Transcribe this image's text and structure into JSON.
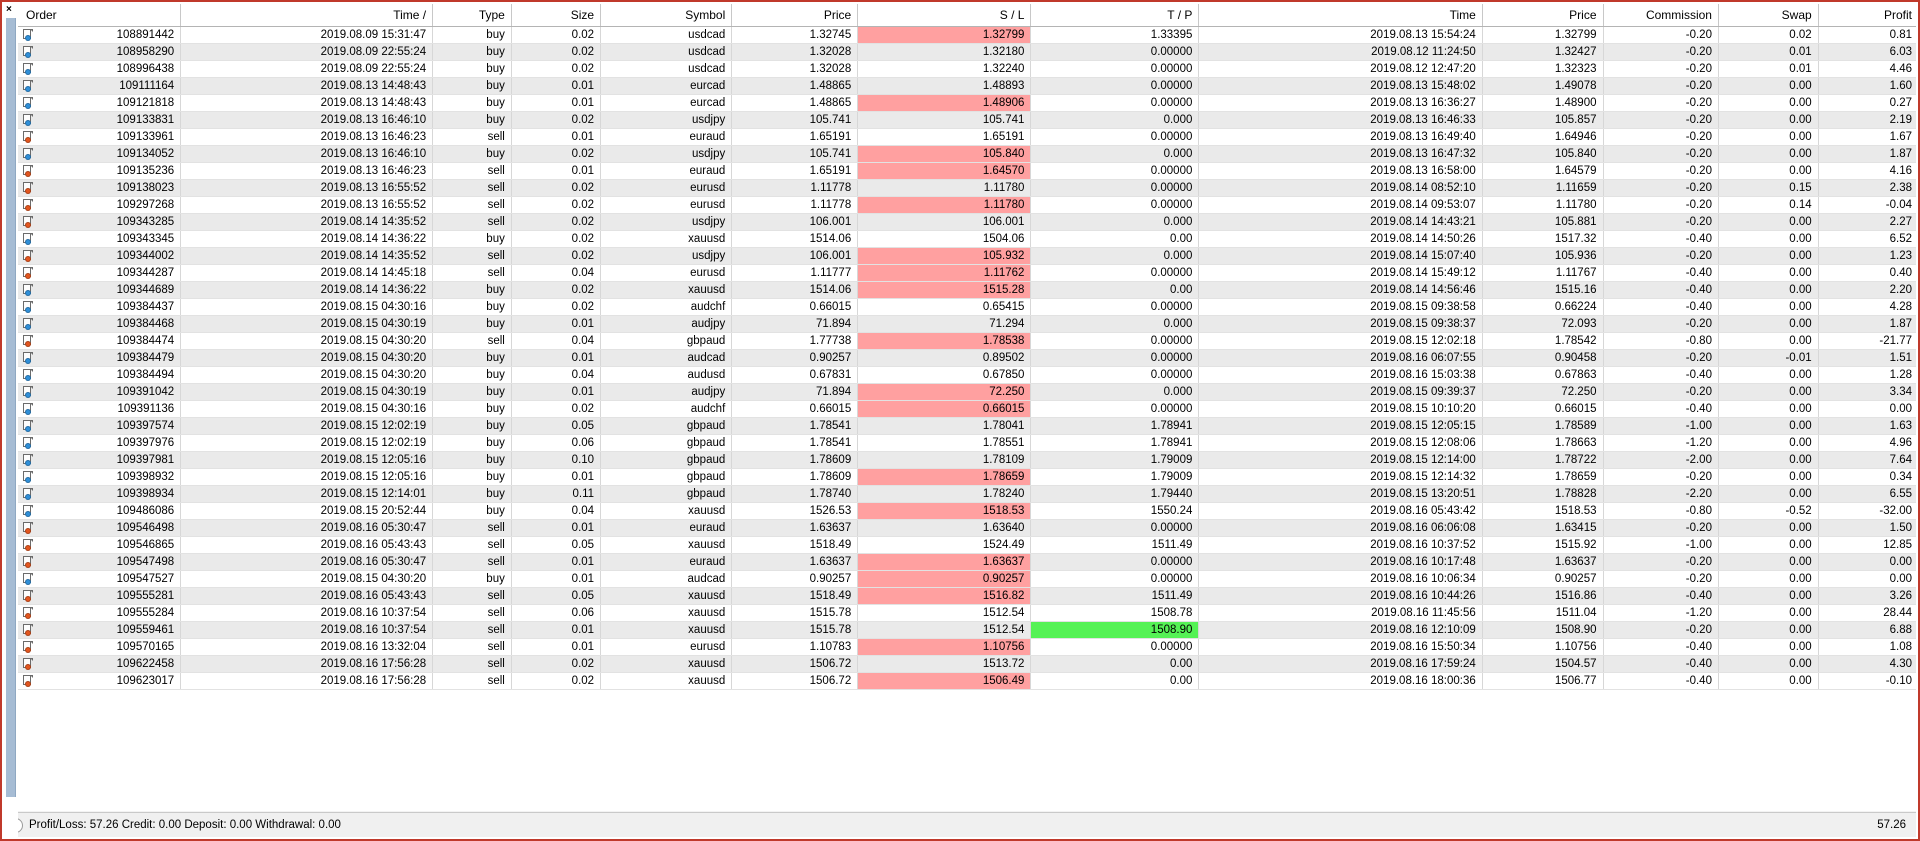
{
  "window": {
    "close_glyph": "×",
    "accent_border": "#c0392b"
  },
  "colors": {
    "highlight_red": "#ffa0a0",
    "highlight_green": "#55f255",
    "row_even": "#eaeaea",
    "row_odd": "#ffffff",
    "buy_dot": "#2f8fd8",
    "sell_dot": "#e2561f"
  },
  "table": {
    "columns": [
      {
        "key": "order",
        "label": "Order",
        "align": "left"
      },
      {
        "key": "time_open",
        "label": "Time  /",
        "align": "right"
      },
      {
        "key": "type",
        "label": "Type",
        "align": "right"
      },
      {
        "key": "size",
        "label": "Size",
        "align": "right"
      },
      {
        "key": "symbol",
        "label": "Symbol",
        "align": "right"
      },
      {
        "key": "price_open",
        "label": "Price",
        "align": "right"
      },
      {
        "key": "sl",
        "label": "S / L",
        "align": "right"
      },
      {
        "key": "tp",
        "label": "T / P",
        "align": "right"
      },
      {
        "key": "time_close",
        "label": "Time",
        "align": "right"
      },
      {
        "key": "price_close",
        "label": "Price",
        "align": "right"
      },
      {
        "key": "commission",
        "label": "Commission",
        "align": "right"
      },
      {
        "key": "swap",
        "label": "Swap",
        "align": "right"
      },
      {
        "key": "profit",
        "label": "Profit",
        "align": "right"
      }
    ],
    "rows": [
      {
        "order": "108891442",
        "time_open": "2019.08.09 15:31:47",
        "type": "buy",
        "size": "0.02",
        "symbol": "usdcad",
        "price_open": "1.32745",
        "sl": "1.32799",
        "sl_hl": "red",
        "tp": "1.33395",
        "tp_hl": "none",
        "time_close": "2019.08.13 15:54:24",
        "price_close": "1.32799",
        "commission": "-0.20",
        "swap": "0.02",
        "profit": "0.81"
      },
      {
        "order": "108958290",
        "time_open": "2019.08.09 22:55:24",
        "type": "buy",
        "size": "0.02",
        "symbol": "usdcad",
        "price_open": "1.32028",
        "sl": "1.32180",
        "sl_hl": "none",
        "tp": "0.00000",
        "tp_hl": "none",
        "time_close": "2019.08.12 11:24:50",
        "price_close": "1.32427",
        "commission": "-0.20",
        "swap": "0.01",
        "profit": "6.03"
      },
      {
        "order": "108996438",
        "time_open": "2019.08.09 22:55:24",
        "type": "buy",
        "size": "0.02",
        "symbol": "usdcad",
        "price_open": "1.32028",
        "sl": "1.32240",
        "sl_hl": "none",
        "tp": "0.00000",
        "tp_hl": "none",
        "time_close": "2019.08.12 12:47:20",
        "price_close": "1.32323",
        "commission": "-0.20",
        "swap": "0.01",
        "profit": "4.46"
      },
      {
        "order": "109111164",
        "time_open": "2019.08.13 14:48:43",
        "type": "buy",
        "size": "0.01",
        "symbol": "eurcad",
        "price_open": "1.48865",
        "sl": "1.48893",
        "sl_hl": "none",
        "tp": "0.00000",
        "tp_hl": "none",
        "time_close": "2019.08.13 15:48:02",
        "price_close": "1.49078",
        "commission": "-0.20",
        "swap": "0.00",
        "profit": "1.60"
      },
      {
        "order": "109121818",
        "time_open": "2019.08.13 14:48:43",
        "type": "buy",
        "size": "0.01",
        "symbol": "eurcad",
        "price_open": "1.48865",
        "sl": "1.48906",
        "sl_hl": "red",
        "tp": "0.00000",
        "tp_hl": "none",
        "time_close": "2019.08.13 16:36:27",
        "price_close": "1.48900",
        "commission": "-0.20",
        "swap": "0.00",
        "profit": "0.27"
      },
      {
        "order": "109133831",
        "time_open": "2019.08.13 16:46:10",
        "type": "buy",
        "size": "0.02",
        "symbol": "usdjpy",
        "price_open": "105.741",
        "sl": "105.741",
        "sl_hl": "none",
        "tp": "0.000",
        "tp_hl": "none",
        "time_close": "2019.08.13 16:46:33",
        "price_close": "105.857",
        "commission": "-0.20",
        "swap": "0.00",
        "profit": "2.19"
      },
      {
        "order": "109133961",
        "time_open": "2019.08.13 16:46:23",
        "type": "sell",
        "size": "0.01",
        "symbol": "euraud",
        "price_open": "1.65191",
        "sl": "1.65191",
        "sl_hl": "none",
        "tp": "0.00000",
        "tp_hl": "none",
        "time_close": "2019.08.13 16:49:40",
        "price_close": "1.64946",
        "commission": "-0.20",
        "swap": "0.00",
        "profit": "1.67"
      },
      {
        "order": "109134052",
        "time_open": "2019.08.13 16:46:10",
        "type": "buy",
        "size": "0.02",
        "symbol": "usdjpy",
        "price_open": "105.741",
        "sl": "105.840",
        "sl_hl": "red",
        "tp": "0.000",
        "tp_hl": "none",
        "time_close": "2019.08.13 16:47:32",
        "price_close": "105.840",
        "commission": "-0.20",
        "swap": "0.00",
        "profit": "1.87"
      },
      {
        "order": "109135236",
        "time_open": "2019.08.13 16:46:23",
        "type": "sell",
        "size": "0.01",
        "symbol": "euraud",
        "price_open": "1.65191",
        "sl": "1.64570",
        "sl_hl": "red",
        "tp": "0.00000",
        "tp_hl": "none",
        "time_close": "2019.08.13 16:58:00",
        "price_close": "1.64579",
        "commission": "-0.20",
        "swap": "0.00",
        "profit": "4.16"
      },
      {
        "order": "109138023",
        "time_open": "2019.08.13 16:55:52",
        "type": "sell",
        "size": "0.02",
        "symbol": "eurusd",
        "price_open": "1.11778",
        "sl": "1.11780",
        "sl_hl": "none",
        "tp": "0.00000",
        "tp_hl": "none",
        "time_close": "2019.08.14 08:52:10",
        "price_close": "1.11659",
        "commission": "-0.20",
        "swap": "0.15",
        "profit": "2.38"
      },
      {
        "order": "109297268",
        "time_open": "2019.08.13 16:55:52",
        "type": "sell",
        "size": "0.02",
        "symbol": "eurusd",
        "price_open": "1.11778",
        "sl": "1.11780",
        "sl_hl": "red",
        "tp": "0.00000",
        "tp_hl": "none",
        "time_close": "2019.08.14 09:53:07",
        "price_close": "1.11780",
        "commission": "-0.20",
        "swap": "0.14",
        "profit": "-0.04"
      },
      {
        "order": "109343285",
        "time_open": "2019.08.14 14:35:52",
        "type": "sell",
        "size": "0.02",
        "symbol": "usdjpy",
        "price_open": "106.001",
        "sl": "106.001",
        "sl_hl": "none",
        "tp": "0.000",
        "tp_hl": "none",
        "time_close": "2019.08.14 14:43:21",
        "price_close": "105.881",
        "commission": "-0.20",
        "swap": "0.00",
        "profit": "2.27"
      },
      {
        "order": "109343345",
        "time_open": "2019.08.14 14:36:22",
        "type": "buy",
        "size": "0.02",
        "symbol": "xauusd",
        "price_open": "1514.06",
        "sl": "1504.06",
        "sl_hl": "none",
        "tp": "0.00",
        "tp_hl": "none",
        "time_close": "2019.08.14 14:50:26",
        "price_close": "1517.32",
        "commission": "-0.40",
        "swap": "0.00",
        "profit": "6.52"
      },
      {
        "order": "109344002",
        "time_open": "2019.08.14 14:35:52",
        "type": "sell",
        "size": "0.02",
        "symbol": "usdjpy",
        "price_open": "106.001",
        "sl": "105.932",
        "sl_hl": "red",
        "tp": "0.000",
        "tp_hl": "none",
        "time_close": "2019.08.14 15:07:40",
        "price_close": "105.936",
        "commission": "-0.20",
        "swap": "0.00",
        "profit": "1.23"
      },
      {
        "order": "109344287",
        "time_open": "2019.08.14 14:45:18",
        "type": "sell",
        "size": "0.04",
        "symbol": "eurusd",
        "price_open": "1.11777",
        "sl": "1.11762",
        "sl_hl": "red",
        "tp": "0.00000",
        "tp_hl": "none",
        "time_close": "2019.08.14 15:49:12",
        "price_close": "1.11767",
        "commission": "-0.40",
        "swap": "0.00",
        "profit": "0.40"
      },
      {
        "order": "109344689",
        "time_open": "2019.08.14 14:36:22",
        "type": "buy",
        "size": "0.02",
        "symbol": "xauusd",
        "price_open": "1514.06",
        "sl": "1515.28",
        "sl_hl": "red",
        "tp": "0.00",
        "tp_hl": "none",
        "time_close": "2019.08.14 14:56:46",
        "price_close": "1515.16",
        "commission": "-0.40",
        "swap": "0.00",
        "profit": "2.20"
      },
      {
        "order": "109384437",
        "time_open": "2019.08.15 04:30:16",
        "type": "buy",
        "size": "0.02",
        "symbol": "audchf",
        "price_open": "0.66015",
        "sl": "0.65415",
        "sl_hl": "none",
        "tp": "0.00000",
        "tp_hl": "none",
        "time_close": "2019.08.15 09:38:58",
        "price_close": "0.66224",
        "commission": "-0.40",
        "swap": "0.00",
        "profit": "4.28"
      },
      {
        "order": "109384468",
        "time_open": "2019.08.15 04:30:19",
        "type": "buy",
        "size": "0.01",
        "symbol": "audjpy",
        "price_open": "71.894",
        "sl": "71.294",
        "sl_hl": "none",
        "tp": "0.000",
        "tp_hl": "none",
        "time_close": "2019.08.15 09:38:37",
        "price_close": "72.093",
        "commission": "-0.20",
        "swap": "0.00",
        "profit": "1.87"
      },
      {
        "order": "109384474",
        "time_open": "2019.08.15 04:30:20",
        "type": "sell",
        "size": "0.04",
        "symbol": "gbpaud",
        "price_open": "1.77738",
        "sl": "1.78538",
        "sl_hl": "red",
        "tp": "0.00000",
        "tp_hl": "none",
        "time_close": "2019.08.15 12:02:18",
        "price_close": "1.78542",
        "commission": "-0.80",
        "swap": "0.00",
        "profit": "-21.77"
      },
      {
        "order": "109384479",
        "time_open": "2019.08.15 04:30:20",
        "type": "buy",
        "size": "0.01",
        "symbol": "audcad",
        "price_open": "0.90257",
        "sl": "0.89502",
        "sl_hl": "none",
        "tp": "0.00000",
        "tp_hl": "none",
        "time_close": "2019.08.16 06:07:55",
        "price_close": "0.90458",
        "commission": "-0.20",
        "swap": "-0.01",
        "profit": "1.51"
      },
      {
        "order": "109384494",
        "time_open": "2019.08.15 04:30:20",
        "type": "buy",
        "size": "0.04",
        "symbol": "audusd",
        "price_open": "0.67831",
        "sl": "0.67850",
        "sl_hl": "none",
        "tp": "0.00000",
        "tp_hl": "none",
        "time_close": "2019.08.16 15:03:38",
        "price_close": "0.67863",
        "commission": "-0.40",
        "swap": "0.00",
        "profit": "1.28"
      },
      {
        "order": "109391042",
        "time_open": "2019.08.15 04:30:19",
        "type": "buy",
        "size": "0.01",
        "symbol": "audjpy",
        "price_open": "71.894",
        "sl": "72.250",
        "sl_hl": "red",
        "tp": "0.000",
        "tp_hl": "none",
        "time_close": "2019.08.15 09:39:37",
        "price_close": "72.250",
        "commission": "-0.20",
        "swap": "0.00",
        "profit": "3.34"
      },
      {
        "order": "109391136",
        "time_open": "2019.08.15 04:30:16",
        "type": "buy",
        "size": "0.02",
        "symbol": "audchf",
        "price_open": "0.66015",
        "sl": "0.66015",
        "sl_hl": "red",
        "tp": "0.00000",
        "tp_hl": "none",
        "time_close": "2019.08.15 10:10:20",
        "price_close": "0.66015",
        "commission": "-0.40",
        "swap": "0.00",
        "profit": "0.00"
      },
      {
        "order": "109397574",
        "time_open": "2019.08.15 12:02:19",
        "type": "buy",
        "size": "0.05",
        "symbol": "gbpaud",
        "price_open": "1.78541",
        "sl": "1.78041",
        "sl_hl": "none",
        "tp": "1.78941",
        "tp_hl": "none",
        "time_close": "2019.08.15 12:05:15",
        "price_close": "1.78589",
        "commission": "-1.00",
        "swap": "0.00",
        "profit": "1.63"
      },
      {
        "order": "109397976",
        "time_open": "2019.08.15 12:02:19",
        "type": "buy",
        "size": "0.06",
        "symbol": "gbpaud",
        "price_open": "1.78541",
        "sl": "1.78551",
        "sl_hl": "none",
        "tp": "1.78941",
        "tp_hl": "none",
        "time_close": "2019.08.15 12:08:06",
        "price_close": "1.78663",
        "commission": "-1.20",
        "swap": "0.00",
        "profit": "4.96"
      },
      {
        "order": "109397981",
        "time_open": "2019.08.15 12:05:16",
        "type": "buy",
        "size": "0.10",
        "symbol": "gbpaud",
        "price_open": "1.78609",
        "sl": "1.78109",
        "sl_hl": "none",
        "tp": "1.79009",
        "tp_hl": "none",
        "time_close": "2019.08.15 12:14:00",
        "price_close": "1.78722",
        "commission": "-2.00",
        "swap": "0.00",
        "profit": "7.64"
      },
      {
        "order": "109398932",
        "time_open": "2019.08.15 12:05:16",
        "type": "buy",
        "size": "0.01",
        "symbol": "gbpaud",
        "price_open": "1.78609",
        "sl": "1.78659",
        "sl_hl": "red",
        "tp": "1.79009",
        "tp_hl": "none",
        "time_close": "2019.08.15 12:14:32",
        "price_close": "1.78659",
        "commission": "-0.20",
        "swap": "0.00",
        "profit": "0.34"
      },
      {
        "order": "109398934",
        "time_open": "2019.08.15 12:14:01",
        "type": "buy",
        "size": "0.11",
        "symbol": "gbpaud",
        "price_open": "1.78740",
        "sl": "1.78240",
        "sl_hl": "none",
        "tp": "1.79440",
        "tp_hl": "none",
        "time_close": "2019.08.15 13:20:51",
        "price_close": "1.78828",
        "commission": "-2.20",
        "swap": "0.00",
        "profit": "6.55"
      },
      {
        "order": "109486086",
        "time_open": "2019.08.15 20:52:44",
        "type": "buy",
        "size": "0.04",
        "symbol": "xauusd",
        "price_open": "1526.53",
        "sl": "1518.53",
        "sl_hl": "red",
        "tp": "1550.24",
        "tp_hl": "none",
        "time_close": "2019.08.16 05:43:42",
        "price_close": "1518.53",
        "commission": "-0.80",
        "swap": "-0.52",
        "profit": "-32.00"
      },
      {
        "order": "109546498",
        "time_open": "2019.08.16 05:30:47",
        "type": "sell",
        "size": "0.01",
        "symbol": "euraud",
        "price_open": "1.63637",
        "sl": "1.63640",
        "sl_hl": "none",
        "tp": "0.00000",
        "tp_hl": "none",
        "time_close": "2019.08.16 06:06:08",
        "price_close": "1.63415",
        "commission": "-0.20",
        "swap": "0.00",
        "profit": "1.50"
      },
      {
        "order": "109546865",
        "time_open": "2019.08.16 05:43:43",
        "type": "sell",
        "size": "0.05",
        "symbol": "xauusd",
        "price_open": "1518.49",
        "sl": "1524.49",
        "sl_hl": "none",
        "tp": "1511.49",
        "tp_hl": "none",
        "time_close": "2019.08.16 10:37:52",
        "price_close": "1515.92",
        "commission": "-1.00",
        "swap": "0.00",
        "profit": "12.85"
      },
      {
        "order": "109547498",
        "time_open": "2019.08.16 05:30:47",
        "type": "sell",
        "size": "0.01",
        "symbol": "euraud",
        "price_open": "1.63637",
        "sl": "1.63637",
        "sl_hl": "red",
        "tp": "0.00000",
        "tp_hl": "none",
        "time_close": "2019.08.16 10:17:48",
        "price_close": "1.63637",
        "commission": "-0.20",
        "swap": "0.00",
        "profit": "0.00"
      },
      {
        "order": "109547527",
        "time_open": "2019.08.15 04:30:20",
        "type": "buy",
        "size": "0.01",
        "symbol": "audcad",
        "price_open": "0.90257",
        "sl": "0.90257",
        "sl_hl": "red",
        "tp": "0.00000",
        "tp_hl": "none",
        "time_close": "2019.08.16 10:06:34",
        "price_close": "0.90257",
        "commission": "-0.20",
        "swap": "0.00",
        "profit": "0.00"
      },
      {
        "order": "109555281",
        "time_open": "2019.08.16 05:43:43",
        "type": "sell",
        "size": "0.05",
        "symbol": "xauusd",
        "price_open": "1518.49",
        "sl": "1516.82",
        "sl_hl": "red",
        "tp": "1511.49",
        "tp_hl": "none",
        "time_close": "2019.08.16 10:44:26",
        "price_close": "1516.86",
        "commission": "-0.40",
        "swap": "0.00",
        "profit": "3.26"
      },
      {
        "order": "109555284",
        "time_open": "2019.08.16 10:37:54",
        "type": "sell",
        "size": "0.06",
        "symbol": "xauusd",
        "price_open": "1515.78",
        "sl": "1512.54",
        "sl_hl": "none",
        "tp": "1508.78",
        "tp_hl": "none",
        "time_close": "2019.08.16 11:45:56",
        "price_close": "1511.04",
        "commission": "-1.20",
        "swap": "0.00",
        "profit": "28.44"
      },
      {
        "order": "109559461",
        "time_open": "2019.08.16 10:37:54",
        "type": "sell",
        "size": "0.01",
        "symbol": "xauusd",
        "price_open": "1515.78",
        "sl": "1512.54",
        "sl_hl": "none",
        "tp": "1508.90",
        "tp_hl": "green",
        "time_close": "2019.08.16 12:10:09",
        "price_close": "1508.90",
        "commission": "-0.20",
        "swap": "0.00",
        "profit": "6.88"
      },
      {
        "order": "109570165",
        "time_open": "2019.08.16 13:32:04",
        "type": "sell",
        "size": "0.01",
        "symbol": "eurusd",
        "price_open": "1.10783",
        "sl": "1.10756",
        "sl_hl": "red",
        "tp": "0.00000",
        "tp_hl": "none",
        "time_close": "2019.08.16 15:50:34",
        "price_close": "1.10756",
        "commission": "-0.40",
        "swap": "0.00",
        "profit": "1.08"
      },
      {
        "order": "109622458",
        "time_open": "2019.08.16 17:56:28",
        "type": "sell",
        "size": "0.02",
        "symbol": "xauusd",
        "price_open": "1506.72",
        "sl": "1513.72",
        "sl_hl": "none",
        "tp": "0.00",
        "tp_hl": "none",
        "time_close": "2019.08.16 17:59:24",
        "price_close": "1504.57",
        "commission": "-0.40",
        "swap": "0.00",
        "profit": "4.30"
      },
      {
        "order": "109623017",
        "time_open": "2019.08.16 17:56:28",
        "type": "sell",
        "size": "0.02",
        "symbol": "xauusd",
        "price_open": "1506.72",
        "sl": "1506.49",
        "sl_hl": "red",
        "tp": "0.00",
        "tp_hl": "none",
        "time_close": "2019.08.16 18:00:36",
        "price_close": "1506.77",
        "commission": "-0.40",
        "swap": "0.00",
        "profit": "-0.10"
      }
    ]
  },
  "statusbar": {
    "summary": "Profit/Loss: 57.26  Credit: 0.00  Deposit: 0.00  Withdrawal: 0.00",
    "total": "57.26"
  }
}
